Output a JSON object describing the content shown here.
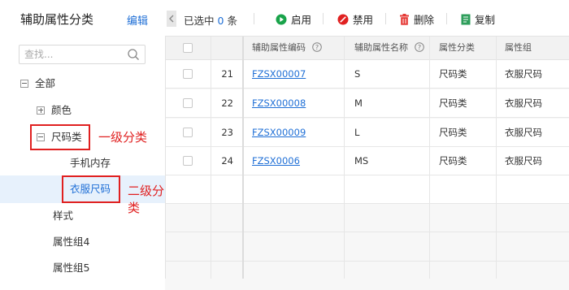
{
  "sidebar": {
    "title": "辅助属性分类",
    "edit_label": "编辑",
    "search_placeholder": "查找...",
    "tree": {
      "root": "全部",
      "color": "颜色",
      "size": "尺码类",
      "size_children": [
        "手机内存",
        "衣服尺码"
      ],
      "style": "样式",
      "group4": "属性组4",
      "group5": "属性组5"
    }
  },
  "annotations": {
    "level1": "一级分类",
    "level2": "二级分类"
  },
  "toolbar": {
    "selected_prefix": "已选中",
    "selected_count": "0",
    "selected_suffix": "条",
    "enable": "启用",
    "disable": "禁用",
    "delete": "删除",
    "copy": "复制"
  },
  "colors": {
    "accent": "#1f6fd6",
    "enable_green": "#19a34a",
    "disable_red": "#e02020",
    "delete_red": "#e53935",
    "copy_green": "#2e9e5b",
    "annotation_red": "#e02020"
  },
  "table": {
    "columns": [
      "辅助属性编码",
      "辅助属性名称",
      "属性分类",
      "属性组"
    ],
    "rows": [
      {
        "no": "21",
        "code": "FZSX00007",
        "name": "S",
        "category": "尺码类",
        "group": "衣服尺码"
      },
      {
        "no": "22",
        "code": "FZSX00008",
        "name": "M",
        "category": "尺码类",
        "group": "衣服尺码"
      },
      {
        "no": "23",
        "code": "FZSX00009",
        "name": "L",
        "category": "尺码类",
        "group": "衣服尺码"
      },
      {
        "no": "24",
        "code": "FZSX0006",
        "name": "MS",
        "category": "尺码类",
        "group": "衣服尺码"
      }
    ]
  }
}
